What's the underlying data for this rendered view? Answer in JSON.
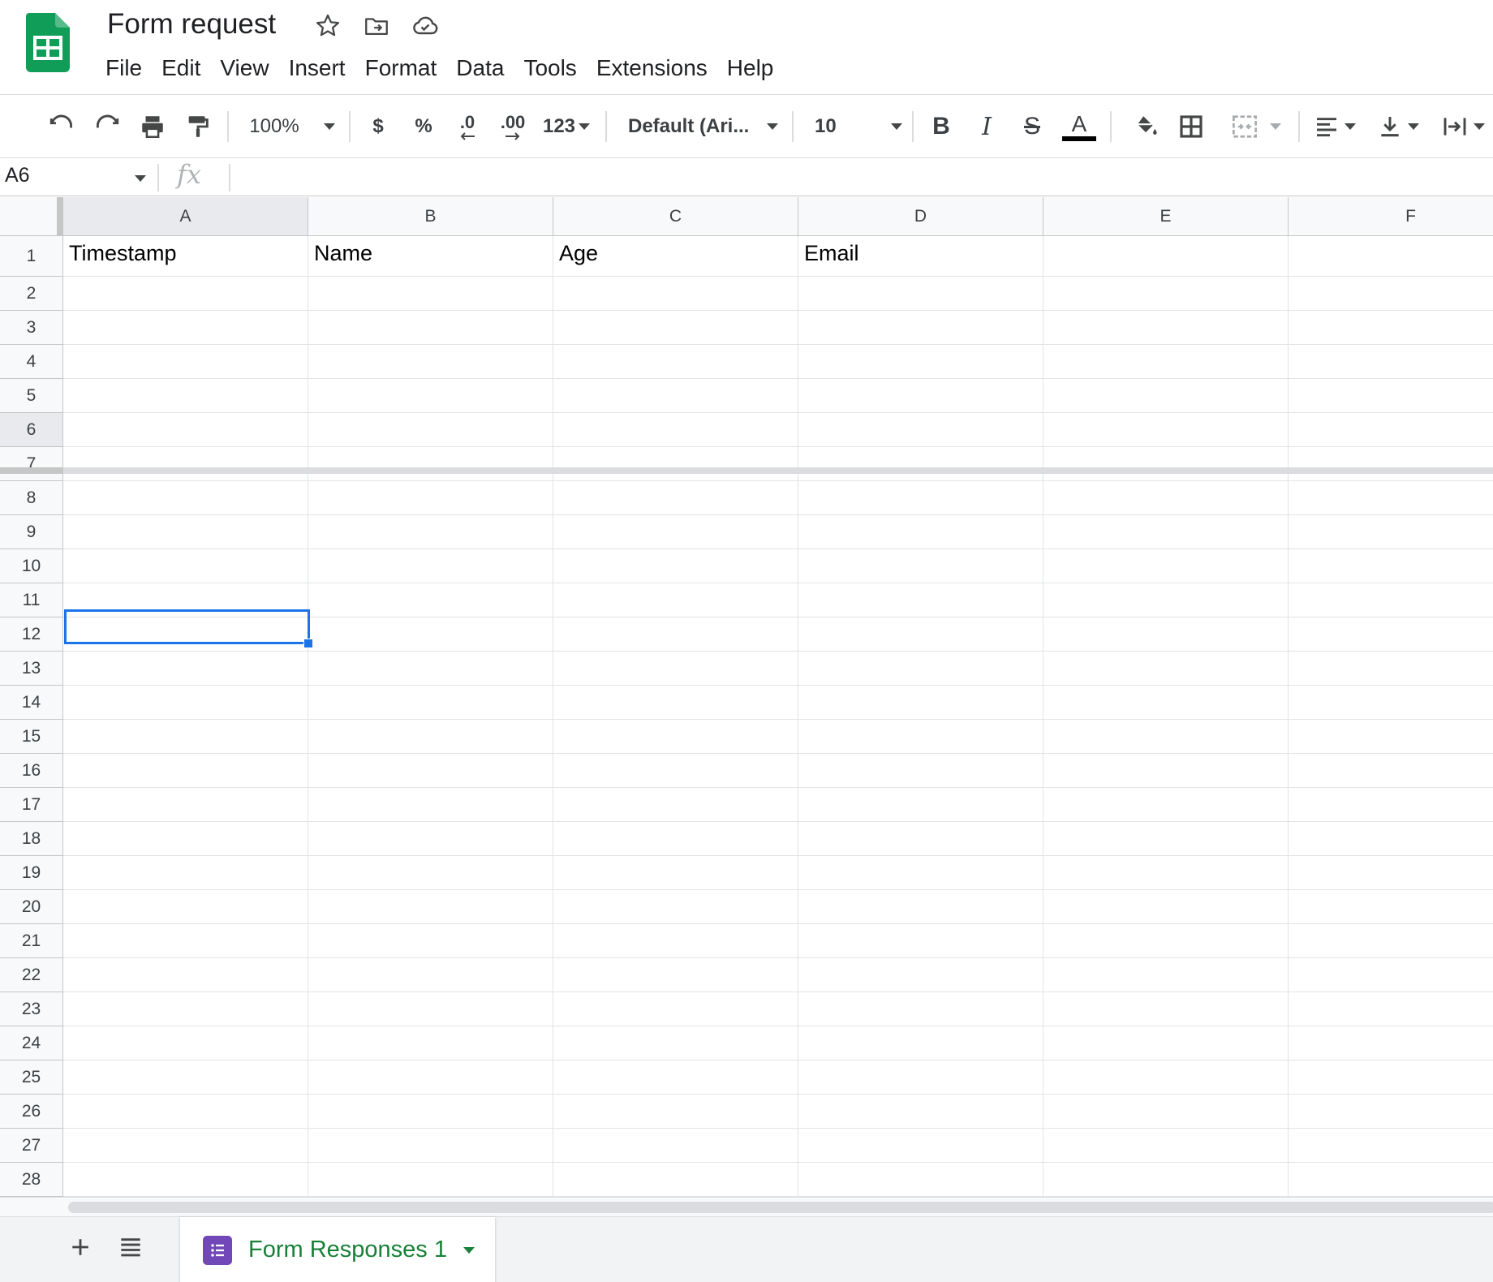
{
  "document": {
    "title": "Form request"
  },
  "menu": [
    {
      "name": "menu-file",
      "label": "File"
    },
    {
      "name": "menu-edit",
      "label": "Edit"
    },
    {
      "name": "menu-view",
      "label": "View"
    },
    {
      "name": "menu-insert",
      "label": "Insert"
    },
    {
      "name": "menu-format",
      "label": "Format"
    },
    {
      "name": "menu-data",
      "label": "Data"
    },
    {
      "name": "menu-tools",
      "label": "Tools"
    },
    {
      "name": "menu-extensions",
      "label": "Extensions"
    },
    {
      "name": "menu-help",
      "label": "Help"
    }
  ],
  "toolbar": {
    "zoom": "100%",
    "currency": "$",
    "percent": "%",
    "decrease_decimal": ".0",
    "increase_decimal": ".00",
    "number_format": "123",
    "font": "Default (Ari...",
    "font_size": "10",
    "bold": "B",
    "italic": "I",
    "strike": "S",
    "text_color_glyph": "A"
  },
  "formula_bar": {
    "cell_ref": "A6",
    "fx": "fx",
    "value": ""
  },
  "grid": {
    "columns": [
      "A",
      "B",
      "C",
      "D",
      "E",
      "F"
    ],
    "selected_column": "A",
    "selected_row": 6,
    "rows": [
      {
        "n": "1",
        "cells": [
          "Timestamp",
          "Name",
          "Age",
          "Email",
          "",
          ""
        ]
      },
      {
        "n": "2",
        "cells": [
          "",
          "",
          "",
          "",
          "",
          ""
        ]
      },
      {
        "n": "3",
        "cells": [
          "",
          "",
          "",
          "",
          "",
          ""
        ]
      },
      {
        "n": "4",
        "cells": [
          "",
          "",
          "",
          "",
          "",
          ""
        ]
      },
      {
        "n": "5",
        "cells": [
          "",
          "",
          "",
          "",
          "",
          ""
        ]
      },
      {
        "n": "6",
        "cells": [
          "",
          "",
          "",
          "",
          "",
          ""
        ]
      },
      {
        "n": "7",
        "cells": [
          "",
          "",
          "",
          "",
          "",
          ""
        ]
      },
      {
        "n": "8",
        "cells": [
          "",
          "",
          "",
          "",
          "",
          ""
        ]
      },
      {
        "n": "9",
        "cells": [
          "",
          "",
          "",
          "",
          "",
          ""
        ]
      },
      {
        "n": "10",
        "cells": [
          "",
          "",
          "",
          "",
          "",
          ""
        ]
      },
      {
        "n": "11",
        "cells": [
          "",
          "",
          "",
          "",
          "",
          ""
        ]
      },
      {
        "n": "12",
        "cells": [
          "",
          "",
          "",
          "",
          "",
          ""
        ]
      },
      {
        "n": "13",
        "cells": [
          "",
          "",
          "",
          "",
          "",
          ""
        ]
      },
      {
        "n": "14",
        "cells": [
          "",
          "",
          "",
          "",
          "",
          ""
        ]
      },
      {
        "n": "15",
        "cells": [
          "",
          "",
          "",
          "",
          "",
          ""
        ]
      },
      {
        "n": "16",
        "cells": [
          "",
          "",
          "",
          "",
          "",
          ""
        ]
      },
      {
        "n": "17",
        "cells": [
          "",
          "",
          "",
          "",
          "",
          ""
        ]
      },
      {
        "n": "18",
        "cells": [
          "",
          "",
          "",
          "",
          "",
          ""
        ]
      },
      {
        "n": "19",
        "cells": [
          "",
          "",
          "",
          "",
          "",
          ""
        ]
      },
      {
        "n": "20",
        "cells": [
          "",
          "",
          "",
          "",
          "",
          ""
        ]
      },
      {
        "n": "21",
        "cells": [
          "",
          "",
          "",
          "",
          "",
          ""
        ]
      },
      {
        "n": "22",
        "cells": [
          "",
          "",
          "",
          "",
          "",
          ""
        ]
      },
      {
        "n": "23",
        "cells": [
          "",
          "",
          "",
          "",
          "",
          ""
        ]
      },
      {
        "n": "24",
        "cells": [
          "",
          "",
          "",
          "",
          "",
          ""
        ]
      },
      {
        "n": "25",
        "cells": [
          "",
          "",
          "",
          "",
          "",
          ""
        ]
      },
      {
        "n": "26",
        "cells": [
          "",
          "",
          "",
          "",
          "",
          ""
        ]
      },
      {
        "n": "27",
        "cells": [
          "",
          "",
          "",
          "",
          "",
          ""
        ]
      },
      {
        "n": "28",
        "cells": [
          "",
          "",
          "",
          "",
          "",
          ""
        ]
      }
    ]
  },
  "sheets": {
    "active_tab": "Form Responses 1"
  },
  "colors": {
    "brand_green": "#0f9d58",
    "selection_blue": "#1a73e8",
    "forms_purple": "#7248b9",
    "tab_text_green": "#188038"
  },
  "icons": [
    "sheets-logo-icon",
    "star-icon",
    "move-folder-icon",
    "cloud-status-icon",
    "undo-icon",
    "redo-icon",
    "print-icon",
    "paint-format-icon",
    "fill-color-icon",
    "borders-icon",
    "merge-cells-icon",
    "horizontal-align-icon",
    "vertical-align-icon",
    "text-wrap-icon",
    "add-icon",
    "list-icon",
    "forms-icon"
  ]
}
